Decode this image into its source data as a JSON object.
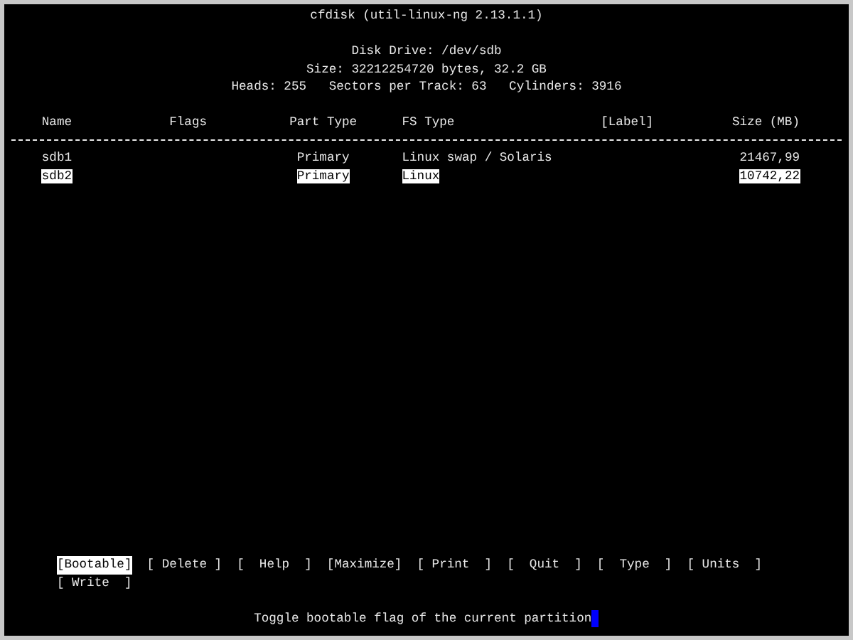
{
  "title": "cfdisk (util-linux-ng 2.13.1.1)",
  "disk_info": [
    "Disk Drive: /dev/sdb",
    "Size: 32212254720 bytes, 32.2 GB",
    "Heads: 255   Sectors per Track: 63   Cylinders: 3916"
  ],
  "table": {
    "columns": [
      "Name",
      "Flags",
      "Part Type",
      "FS Type",
      "[Label]",
      "Size (MB)"
    ],
    "rows": [
      {
        "name": "sdb1",
        "flags": "",
        "part_type": "Primary",
        "fs_type": "Linux swap / Solaris",
        "label": "",
        "size": "21467,99",
        "selected": false
      },
      {
        "name": "sdb2",
        "flags": "",
        "part_type": "Primary",
        "fs_type": "Linux",
        "label": "",
        "size": "10742,22",
        "selected": true
      }
    ]
  },
  "menu": [
    {
      "label": "[Bootable]",
      "selected": true
    },
    {
      "label": "[ Delete ]",
      "selected": false
    },
    {
      "label": "[  Help  ]",
      "selected": false
    },
    {
      "label": "[Maximize]",
      "selected": false
    },
    {
      "label": "[ Print  ]",
      "selected": false
    },
    {
      "label": "[  Quit  ]",
      "selected": false
    },
    {
      "label": "[  Type  ]",
      "selected": false
    },
    {
      "label": "[ Units  ]",
      "selected": false
    },
    {
      "label": "[ Write  ]",
      "selected": false
    }
  ],
  "status": "Toggle bootable flag of the current partition"
}
